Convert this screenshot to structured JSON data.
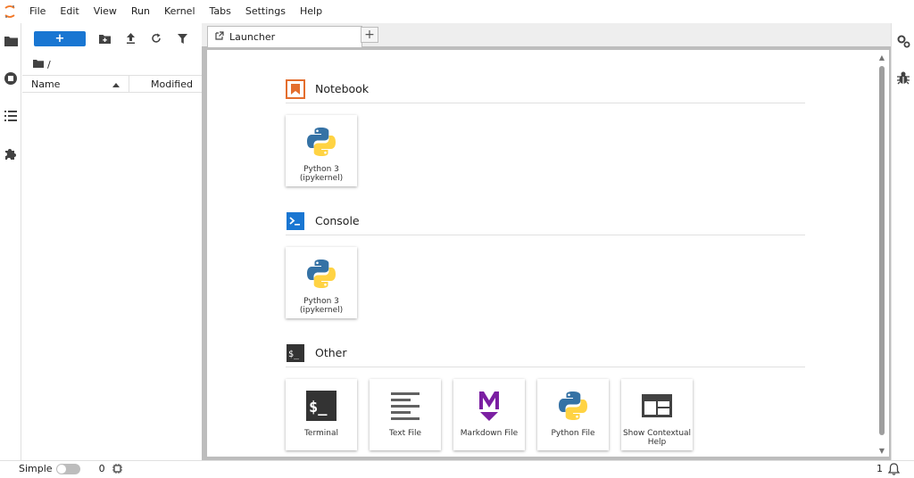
{
  "menu": [
    "File",
    "Edit",
    "View",
    "Run",
    "Kernel",
    "Tabs",
    "Settings",
    "Help"
  ],
  "left_bar": {
    "icons": [
      "folder-icon",
      "running-kernels-icon",
      "table-of-contents-icon",
      "extension-icon"
    ]
  },
  "file_browser": {
    "new_button_label": "+",
    "breadcrumb": "/",
    "columns": {
      "name": "Name",
      "modified": "Modified"
    },
    "items": []
  },
  "tabs": [
    {
      "label": "Launcher",
      "active": true
    }
  ],
  "add_tab_label": "+",
  "launcher": {
    "sections": [
      {
        "title": "Notebook",
        "icon": "notebook-icon",
        "items": [
          {
            "label_line1": "Python 3",
            "label_line2": "(ipykernel)",
            "icon": "python-logo-icon"
          }
        ]
      },
      {
        "title": "Console",
        "icon": "console-icon",
        "items": [
          {
            "label_line1": "Python 3",
            "label_line2": "(ipykernel)",
            "icon": "python-logo-icon"
          }
        ]
      },
      {
        "title": "Other",
        "icon": "terminal-section-icon",
        "items": [
          {
            "label_line1": "Terminal",
            "label_line2": "",
            "icon": "terminal-icon"
          },
          {
            "label_line1": "Text File",
            "label_line2": "",
            "icon": "text-file-icon"
          },
          {
            "label_line1": "Markdown File",
            "label_line2": "",
            "icon": "markdown-icon"
          },
          {
            "label_line1": "Python File",
            "label_line2": "",
            "icon": "python-logo-icon"
          },
          {
            "label_line1": "Show Contextual",
            "label_line2": "Help",
            "icon": "contextual-help-icon"
          }
        ]
      }
    ]
  },
  "right_bar": {
    "icons": [
      "property-inspector-icon",
      "debugger-icon"
    ]
  },
  "status": {
    "simple_label": "Simple",
    "simple_enabled": false,
    "kernel_count": "0",
    "notification_count": "1"
  },
  "colors": {
    "accent": "#1976d2",
    "notebook_orange": "#e46e2e",
    "console_blue": "#1976d2",
    "markdown_purple": "#7b1fa2",
    "python_blue": "#3572a5",
    "python_yellow": "#ffd343"
  }
}
